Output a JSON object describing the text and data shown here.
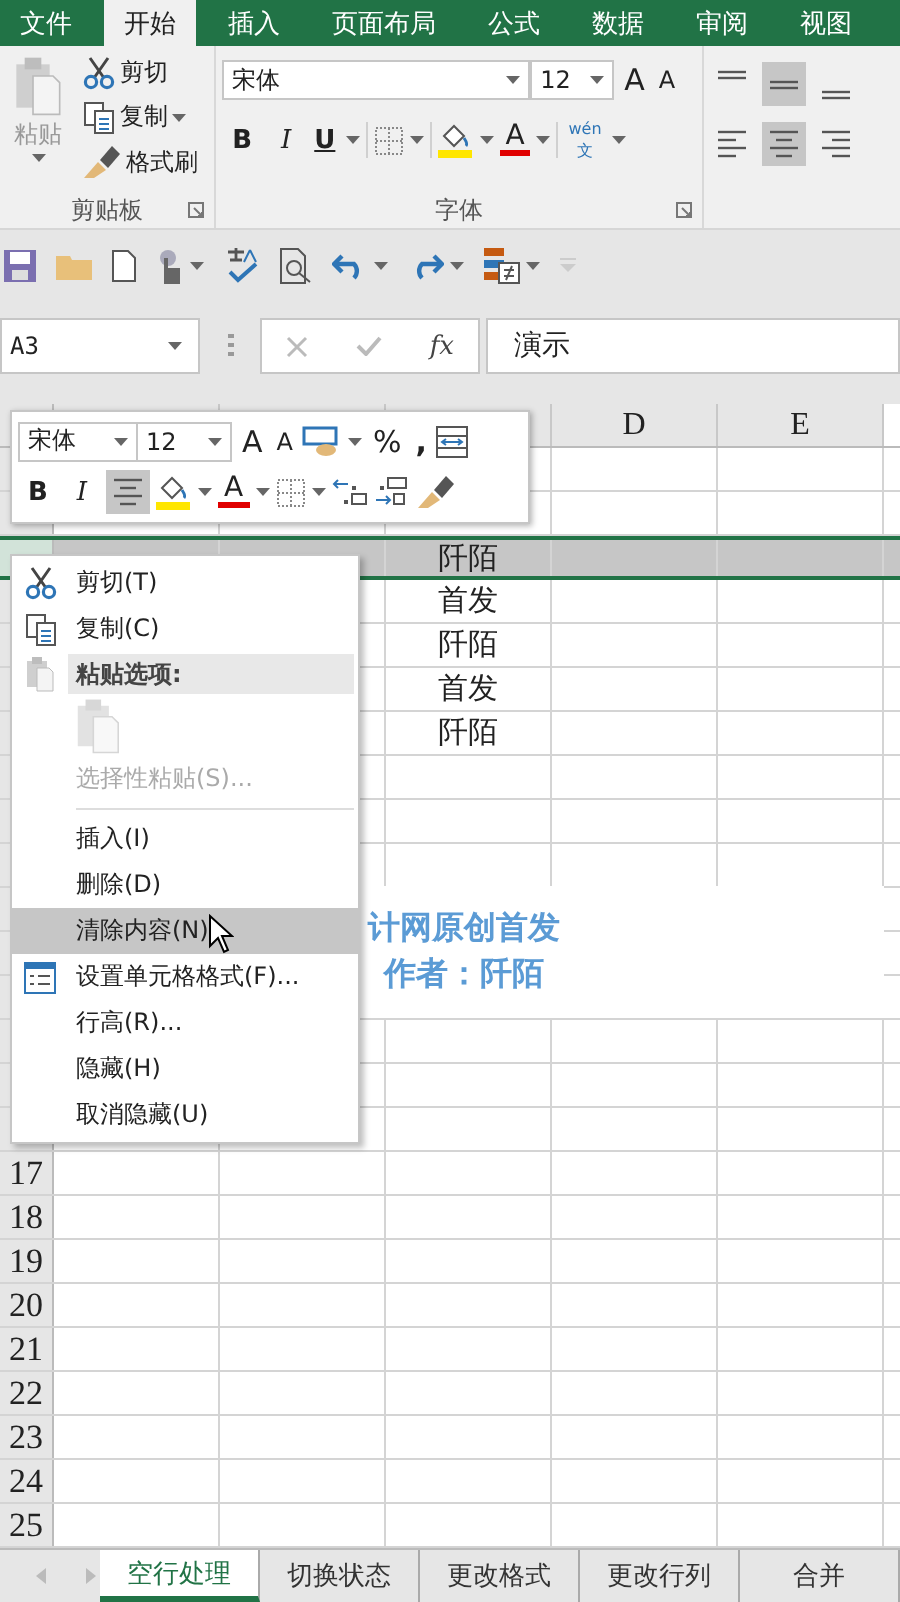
{
  "ribbon_tabs": [
    {
      "label": "文件",
      "selected": false
    },
    {
      "label": "开始",
      "selected": true
    },
    {
      "label": "插入",
      "selected": false
    },
    {
      "label": "页面布局",
      "selected": false
    },
    {
      "label": "公式",
      "selected": false
    },
    {
      "label": "数据",
      "selected": false
    },
    {
      "label": "审阅",
      "selected": false
    },
    {
      "label": "视图",
      "selected": false
    }
  ],
  "clipboard": {
    "paste": {
      "label": "粘贴",
      "disabled": true
    },
    "cut": "剪切",
    "copy": "复制",
    "format_painter": "格式刷",
    "group_label": "剪贴板"
  },
  "font": {
    "font_name": "宋体",
    "font_size": "12",
    "grow": "A",
    "shrink": "A",
    "bold": "B",
    "italic": "I",
    "underline": "U",
    "font_color": "A",
    "phonetic_top": "wén",
    "phonetic_bottom": "文",
    "group_label": "字体"
  },
  "alignment": [
    {
      "kind": "top",
      "selected": false
    },
    {
      "kind": "middle",
      "selected": true
    },
    {
      "kind": "bottom",
      "selected": false
    },
    {
      "kind": "left",
      "selected": false
    },
    {
      "kind": "center",
      "selected": true
    },
    {
      "kind": "right",
      "selected": false
    }
  ],
  "formula_bar": {
    "name_box": "A3",
    "fx": "fx",
    "value": "演示"
  },
  "column_headers": [
    "D",
    "E"
  ],
  "rows": [
    {
      "selected": false
    },
    {
      "selected": false
    },
    {
      "selected": true,
      "cells": {
        "C": "阡陌"
      }
    },
    {
      "selected": false,
      "cells": {
        "C": "首发"
      }
    },
    {
      "selected": false,
      "cells": {
        "C": "阡陌"
      }
    },
    {
      "selected": false,
      "cells": {
        "C": "首发"
      }
    },
    {
      "selected": false,
      "cells": {
        "C": "阡陌"
      }
    },
    {
      "selected": false
    },
    {
      "selected": false
    },
    {
      "selected": false
    },
    {
      "selected": false
    },
    {
      "selected": false
    },
    {
      "selected": false
    },
    {
      "selected": false
    },
    {
      "selected": false
    },
    {
      "selected": false
    },
    {
      "selected": false,
      "number": "17"
    },
    {
      "selected": false,
      "number": "18"
    },
    {
      "selected": false,
      "number": "19"
    },
    {
      "selected": false,
      "number": "20"
    },
    {
      "selected": false,
      "number": "21"
    },
    {
      "selected": false,
      "number": "22"
    },
    {
      "selected": false,
      "number": "23"
    },
    {
      "selected": false,
      "number": "24"
    },
    {
      "selected": false,
      "number": "25"
    }
  ],
  "text_box": {
    "lines": [
      "计网原创首发",
      "作者：阡陌"
    ]
  },
  "mini_toolbar": {
    "font_name": "宋体",
    "font_size": "12",
    "grow": "A",
    "shrink": "A",
    "percent": "%",
    "comma": ",",
    "bold": "B",
    "italic": "I",
    "center_align": {
      "on": true
    },
    "font_color": "A"
  },
  "context_menu": [
    {
      "kind": "command",
      "label": "剪切(T)",
      "disabled": false,
      "selected": false
    },
    {
      "kind": "command",
      "label": "复制(C)",
      "disabled": false,
      "selected": false
    },
    {
      "kind": "header",
      "label": "粘贴选项:"
    },
    {
      "kind": "paste-options",
      "disabled": true
    },
    {
      "kind": "command",
      "label": "选择性粘贴(S)...",
      "disabled": true,
      "selected": false
    },
    {
      "kind": "separator"
    },
    {
      "kind": "command",
      "label": "插入(I)",
      "disabled": false,
      "selected": false
    },
    {
      "kind": "command",
      "label": "删除(D)",
      "disabled": false,
      "selected": false
    },
    {
      "kind": "command",
      "label": "清除内容(N)",
      "disabled": false,
      "selected": true
    },
    {
      "kind": "command",
      "label": "设置单元格格式(F)...",
      "disabled": false,
      "selected": false
    },
    {
      "kind": "command",
      "label": "行高(R)...",
      "disabled": false,
      "selected": false
    },
    {
      "kind": "command",
      "label": "隐藏(H)",
      "disabled": false,
      "selected": false
    },
    {
      "kind": "command",
      "label": "取消隐藏(U)",
      "disabled": false,
      "selected": false
    }
  ],
  "sheet_tabs": [
    {
      "label": "空行处理",
      "selected": true
    },
    {
      "label": "切换状态",
      "selected": false
    },
    {
      "label": "更改格式",
      "selected": false
    },
    {
      "label": "更改行列",
      "selected": false
    },
    {
      "label": "合并",
      "selected": false
    }
  ]
}
